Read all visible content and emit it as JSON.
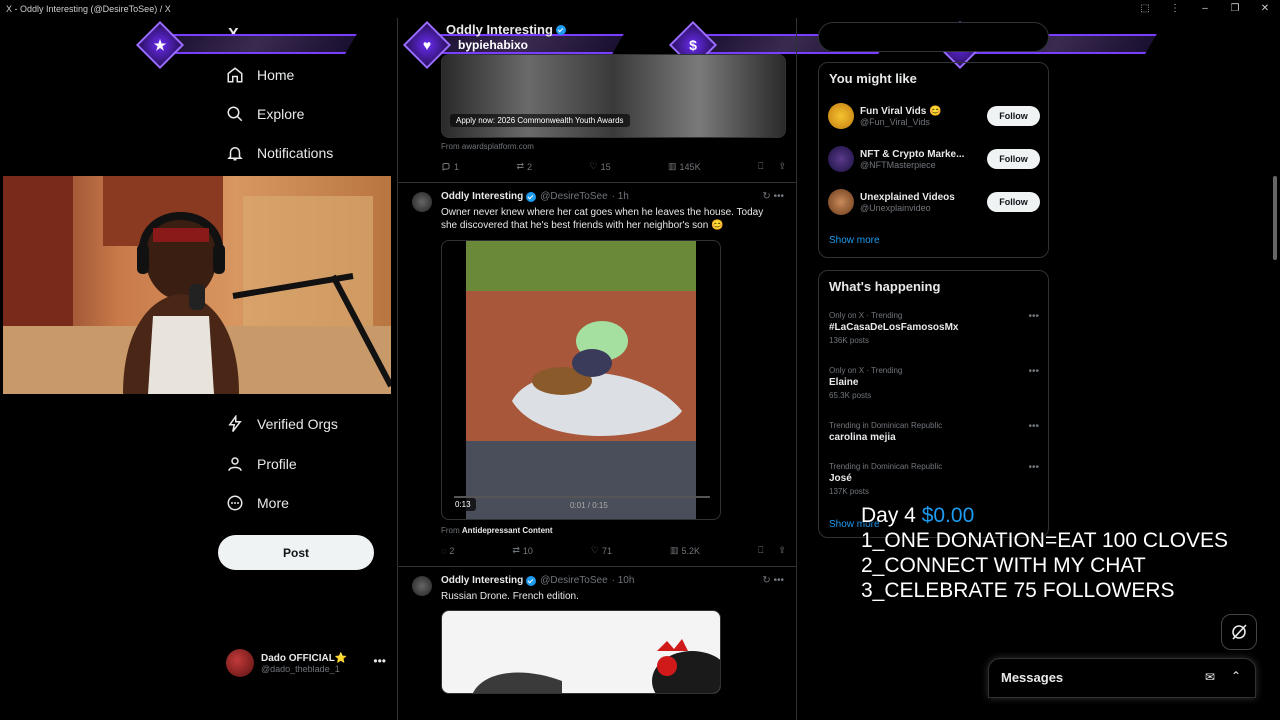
{
  "window": {
    "title": "X - Oddly Interesting (@DesireToSee) / X"
  },
  "nav": {
    "items": [
      {
        "label": "Home",
        "icon": "home-icon"
      },
      {
        "label": "Explore",
        "icon": "search-icon"
      },
      {
        "label": "Notifications",
        "icon": "bell-icon"
      },
      {
        "label": "Verified Orgs",
        "icon": "lightning-icon"
      },
      {
        "label": "Profile",
        "icon": "person-icon"
      },
      {
        "label": "More",
        "icon": "more-circle-icon"
      }
    ],
    "post_label": "Post",
    "account": {
      "name": "Dado OFFICIAL⭐",
      "handle": "@dado_theblade_1"
    }
  },
  "overlay": {
    "banners": [
      {
        "symbol": "★",
        "text": ""
      },
      {
        "symbol": "♥",
        "text": "bypiehabixo"
      },
      {
        "symbol": "$",
        "text": ""
      },
      {
        "symbol": "◆",
        "text": ""
      }
    ],
    "stream": {
      "day": "Day 4",
      "amount": "$0.00",
      "line1": "1_ONE DONATION=EAT 100 CLOVES",
      "line2": "2_CONNECT WITH MY CHAT",
      "line3": "3_CELEBRATE 75 FOLLOWERS"
    }
  },
  "feed": {
    "tweet1": {
      "name": "Oddly Interesting",
      "media_caption": "Apply now: 2026 Commonwealth Youth Awards",
      "from": "From awardsplatform.com",
      "replies": "1",
      "reposts": "2",
      "likes": "15",
      "views": "145K"
    },
    "tweet2": {
      "name": "Oddly Interesting",
      "handle": "@DesireToSee",
      "time": "· 1h",
      "text": "Owner never knew where her cat goes when he leaves the house. Today she discovered that he's best friends with her neighbor's son 😊",
      "video_elapsed": "0:13",
      "video_time": "0:01 / 0:15",
      "from_prefix": "From",
      "from_account": "Antidepressant Content",
      "replies": "2",
      "reposts": "10",
      "likes": "71",
      "views": "5.2K"
    },
    "tweet3": {
      "name": "Oddly Interesting",
      "handle": "@DesireToSee",
      "time": "· 10h",
      "text": "Russian Drone. French edition."
    }
  },
  "sidebar": {
    "might_like": {
      "title": "You might like",
      "suggestions": [
        {
          "name": "Fun Viral Vids 😊",
          "handle": "@Fun_Viral_Vids",
          "follow": "Follow"
        },
        {
          "name": "NFT & Crypto Marke...",
          "handle": "@NFTMasterpiece",
          "follow": "Follow"
        },
        {
          "name": "Unexplained Videos",
          "handle": "@Unexplainvideo",
          "follow": "Follow"
        }
      ],
      "show_more": "Show more"
    },
    "happening": {
      "title": "What's happening",
      "trends": [
        {
          "context": "Only on X · Trending",
          "topic": "#LaCasaDeLosFamososMx",
          "posts": "136K posts"
        },
        {
          "context": "Only on X · Trending",
          "topic": "Elaine",
          "posts": "65.3K posts"
        },
        {
          "context": "Trending in Dominican Republic",
          "topic": "carolina mejia",
          "posts": ""
        },
        {
          "context": "Trending in Dominican Republic",
          "topic": "José",
          "posts": "137K posts"
        }
      ],
      "show_more": "Show more"
    }
  },
  "messages": {
    "label": "Messages"
  }
}
